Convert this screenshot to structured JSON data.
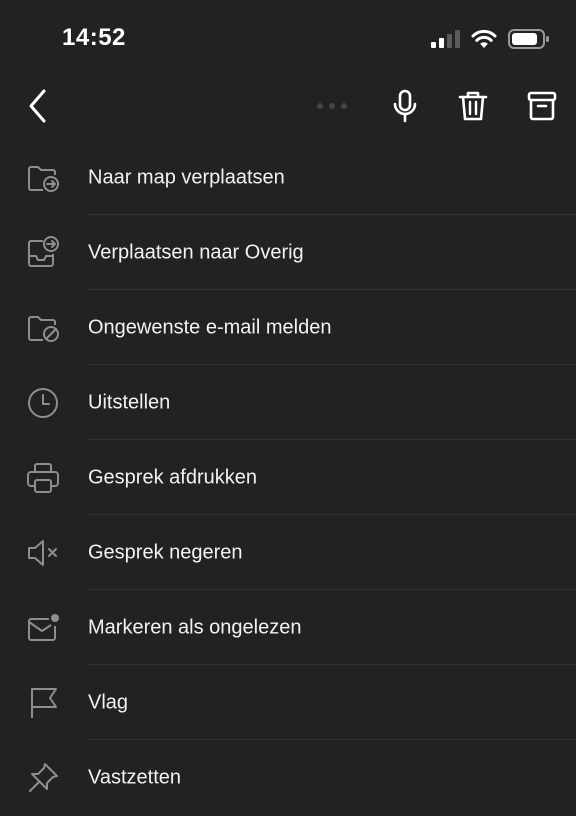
{
  "status_bar": {
    "time": "14:52",
    "icons": [
      "cellular-signal-icon",
      "wifi-icon",
      "battery-icon"
    ]
  },
  "toolbar": {
    "icons": [
      "back-chevron-icon",
      "more-dots-icon",
      "microphone-icon",
      "trash-icon",
      "archive-icon"
    ]
  },
  "menu": {
    "items": [
      {
        "label": "Naar map verplaatsen",
        "icon": "folder-move-icon"
      },
      {
        "label": "Verplaatsen naar Overig",
        "icon": "inbox-move-icon"
      },
      {
        "label": "Ongewenste e-mail melden",
        "icon": "folder-block-icon"
      },
      {
        "label": "Uitstellen",
        "icon": "clock-icon"
      },
      {
        "label": "Gesprek afdrukken",
        "icon": "printer-icon"
      },
      {
        "label": "Gesprek negeren",
        "icon": "speaker-mute-icon"
      },
      {
        "label": "Markeren als ongelezen",
        "icon": "mail-unread-icon"
      },
      {
        "label": "Vlag",
        "icon": "flag-icon"
      },
      {
        "label": "Vastzetten",
        "icon": "pin-icon"
      }
    ]
  },
  "colors": {
    "background": "#222222",
    "text": "#f2f2f2",
    "icon": "#8e8e8e",
    "divider": "#333333"
  }
}
